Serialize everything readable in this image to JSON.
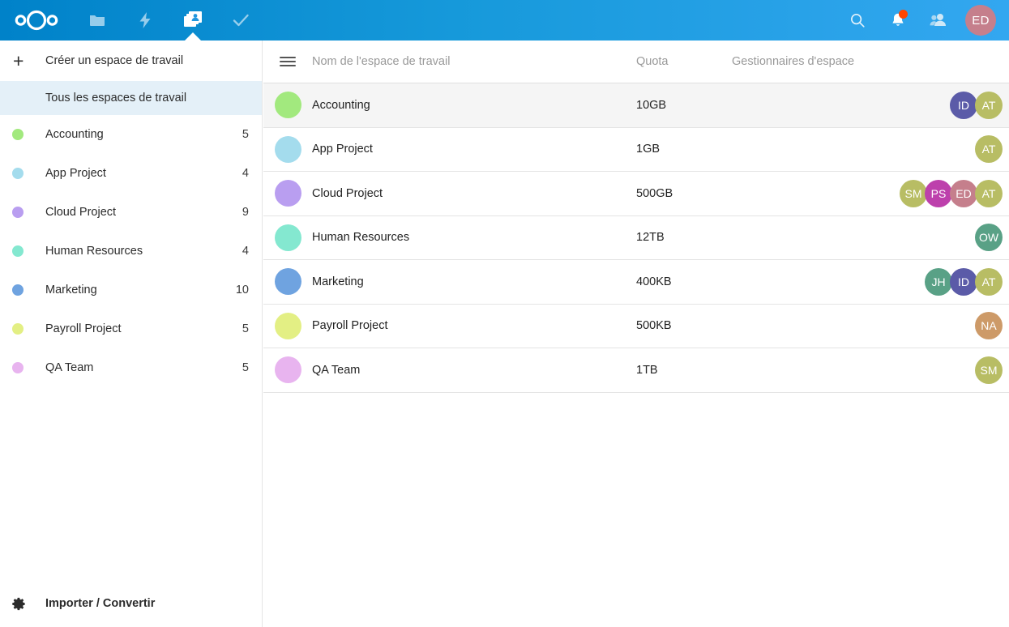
{
  "header": {
    "logo_name": "nextcloud-logo",
    "apps": [
      {
        "name": "files-app",
        "icon": "folder-icon",
        "active": false
      },
      {
        "name": "activity-app",
        "icon": "lightning-bolt-icon",
        "active": false
      },
      {
        "name": "workspace-app",
        "icon": "workspace-group-icon",
        "active": true
      },
      {
        "name": "tasks-app",
        "icon": "checkmark-icon",
        "active": false
      }
    ],
    "search_icon": "search-icon",
    "notifications_icon": "bell-icon",
    "notifications_badge": true,
    "contacts_icon": "contacts-icon",
    "user_initials": "ED",
    "user_avatar_color": "#c57f8c",
    "bg_from": "#0082c9",
    "bg_to": "#33a7f0"
  },
  "sidebar": {
    "create_label": "Créer un espace de travail",
    "create_icon": "plus-icon",
    "all_workspaces_label": "Tous les espaces de travail",
    "items": [
      {
        "label": "Accounting",
        "count": "5",
        "color": "#a2e97e"
      },
      {
        "label": "App Project",
        "count": "4",
        "color": "#a4dced"
      },
      {
        "label": "Cloud Project",
        "count": "9",
        "color": "#b99ef0"
      },
      {
        "label": "Human Resources",
        "count": "4",
        "color": "#84e8d0"
      },
      {
        "label": "Marketing",
        "count": "10",
        "color": "#6fa3e0"
      },
      {
        "label": "Payroll Project",
        "count": "5",
        "color": "#e3ef84"
      },
      {
        "label": "QA Team",
        "count": "5",
        "color": "#e8b4ef"
      }
    ],
    "footer_label": "Importer / Convertir",
    "footer_icon": "gear-icon",
    "selected_bg": "#e4f0f8"
  },
  "table": {
    "menu_icon": "hamburger-icon",
    "columns": {
      "name": "Nom de l'espace de travail",
      "quota": "Quota",
      "managers": "Gestionnaires d'espace"
    },
    "rows": [
      {
        "name": "Accounting",
        "quota": "10GB",
        "color": "#a2e97e",
        "hovered": true,
        "managers": [
          {
            "initials": "ID",
            "color": "#5b5ba8"
          },
          {
            "initials": "AT",
            "color": "#b8bd64"
          }
        ]
      },
      {
        "name": "App Project",
        "quota": "1GB",
        "color": "#a4dced",
        "hovered": false,
        "managers": [
          {
            "initials": "AT",
            "color": "#b8bd64"
          }
        ]
      },
      {
        "name": "Cloud Project",
        "quota": "500GB",
        "color": "#b99ef0",
        "hovered": false,
        "managers": [
          {
            "initials": "SM",
            "color": "#b8bd64"
          },
          {
            "initials": "PS",
            "color": "#bd40ac"
          },
          {
            "initials": "ED",
            "color": "#c57f8c"
          },
          {
            "initials": "AT",
            "color": "#b8bd64"
          }
        ]
      },
      {
        "name": "Human Resources",
        "quota": "12TB",
        "color": "#84e8d0",
        "hovered": false,
        "managers": [
          {
            "initials": "OW",
            "color": "#59a186"
          }
        ]
      },
      {
        "name": "Marketing",
        "quota": "400KB",
        "color": "#6fa3e0",
        "hovered": false,
        "managers": [
          {
            "initials": "JH",
            "color": "#59a186"
          },
          {
            "initials": "ID",
            "color": "#5b5ba8"
          },
          {
            "initials": "AT",
            "color": "#b8bd64"
          }
        ]
      },
      {
        "name": "Payroll Project",
        "quota": "500KB",
        "color": "#e3ef84",
        "hovered": false,
        "managers": [
          {
            "initials": "NA",
            "color": "#cd9a68"
          }
        ]
      },
      {
        "name": "QA Team",
        "quota": "1TB",
        "color": "#e8b4ef",
        "hovered": false,
        "managers": [
          {
            "initials": "SM",
            "color": "#b8bd64"
          }
        ]
      }
    ]
  }
}
